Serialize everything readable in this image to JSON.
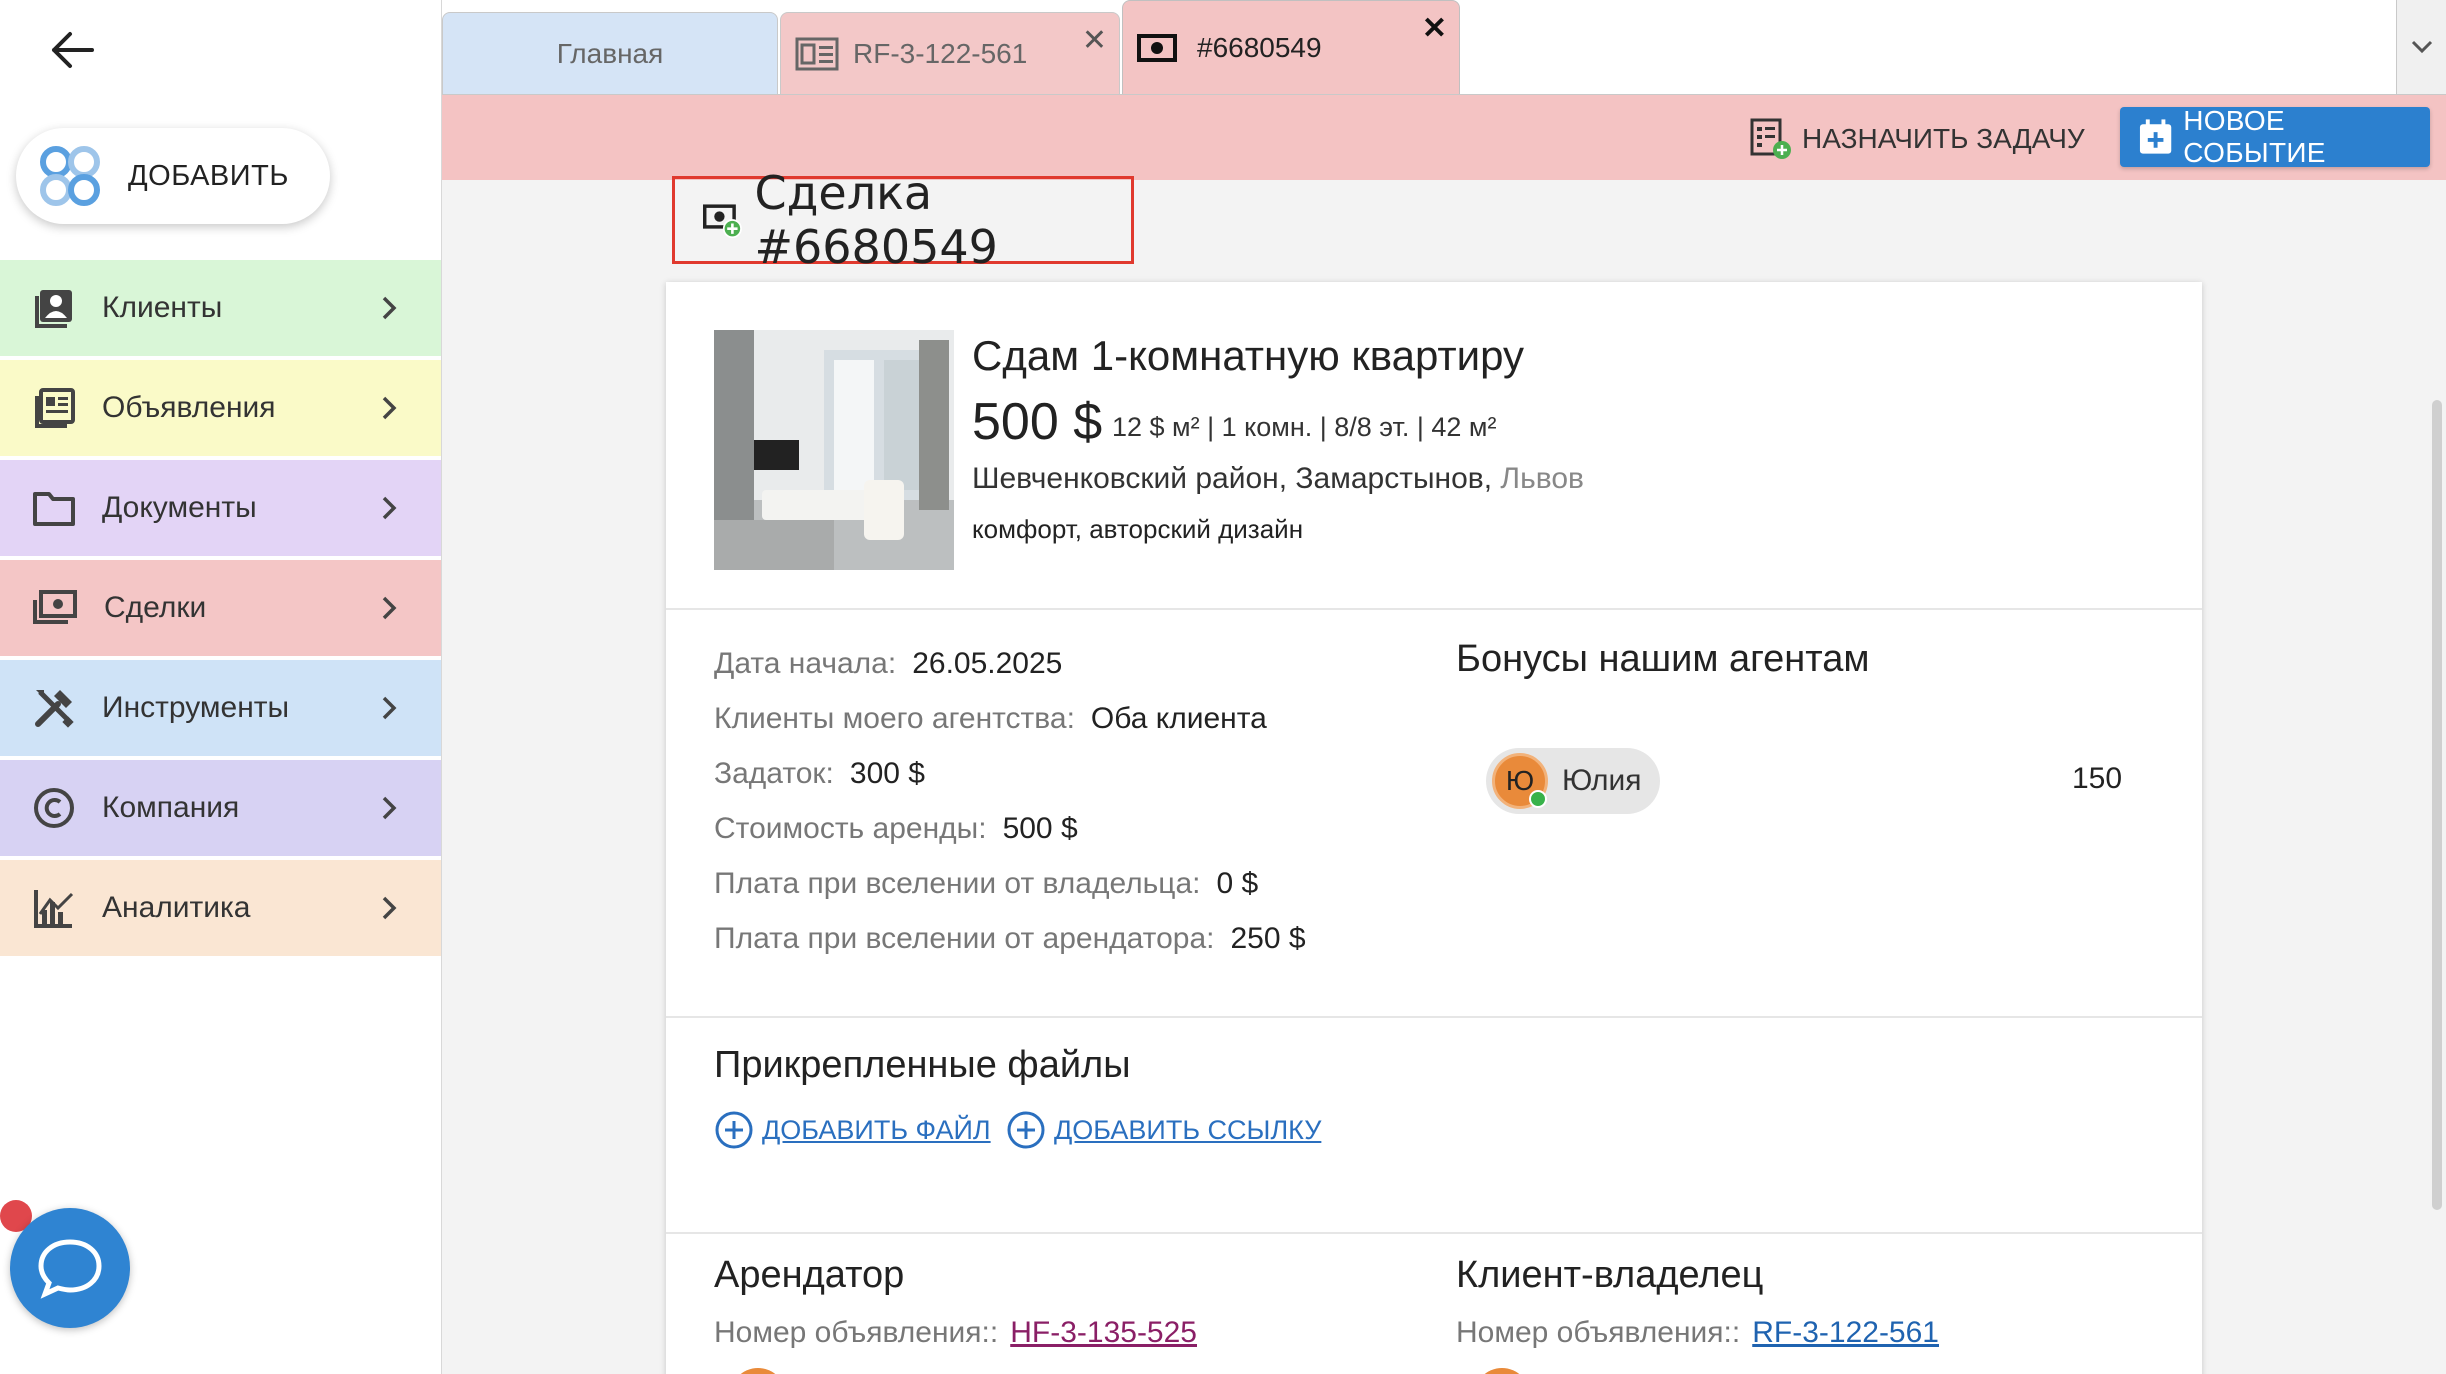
{
  "sidebar": {
    "add_label": "ДОБАВИТЬ",
    "items": [
      {
        "label": "Клиенты",
        "color": "#d9f6d7",
        "icon": "contacts-icon"
      },
      {
        "label": "Объявления",
        "color": "#fafac8",
        "icon": "listings-icon"
      },
      {
        "label": "Документы",
        "color": "#e3d4f6",
        "icon": "folder-icon"
      },
      {
        "label": "Сделки",
        "color": "#f4c6c6",
        "icon": "cash-icon"
      },
      {
        "label": "Инструменты",
        "color": "#cfe3f7",
        "icon": "tools-icon"
      },
      {
        "label": "Компания",
        "color": "#d7d2f3",
        "icon": "copyright-icon"
      },
      {
        "label": "Аналитика",
        "color": "#fae6d3",
        "icon": "analytics-icon"
      }
    ]
  },
  "tabs": [
    {
      "label": "Главная"
    },
    {
      "label": "RF-3-122-561"
    },
    {
      "label": "#6680549"
    }
  ],
  "actions": {
    "assign_task": "НАЗНАЧИТЬ ЗАДАЧУ",
    "new_event": "НОВОЕ СОБЫТИЕ"
  },
  "deal": {
    "title": "Сделка #6680549",
    "listing": {
      "title": "Сдам 1-комнатную квартиру",
      "price": "500 $",
      "details": "12 $ м² | 1 комн. | 8/8 эт. | 42 м²",
      "address": "Шевченковский район, Замарстынов,",
      "city": "Львов",
      "features": "комфорт, авторский дизайн"
    },
    "info": [
      {
        "key": "Дата начала:",
        "value": "26.05.2025"
      },
      {
        "key": "Клиенты моего агентства:",
        "value": "Оба клиента"
      },
      {
        "key": "Задаток:",
        "value": "300 $"
      },
      {
        "key": "Стоимость аренды:",
        "value": "500 $"
      },
      {
        "key": "Плата при вселении от владельца:",
        "value": "0 $"
      },
      {
        "key": "Плата при вселении от арендатора:",
        "value": "250 $"
      }
    ],
    "bonus": {
      "title": "Бонусы нашим агентам",
      "agent_initial": "Ю",
      "agent_name": "Юлия",
      "value": "150"
    },
    "files": {
      "title": "Прикрепленные файлы",
      "add_file": "ДОБАВИТЬ ФАЙЛ",
      "add_link": "ДОБАВИТЬ ССЫЛКУ"
    },
    "tenant": {
      "title": "Арендатор",
      "listing_label": "Номер объявления::",
      "listing_id": "HF-3-135-525"
    },
    "owner": {
      "title": "Клиент-владелец",
      "listing_label": "Номер объявления::",
      "listing_id": "RF-3-122-561"
    }
  }
}
